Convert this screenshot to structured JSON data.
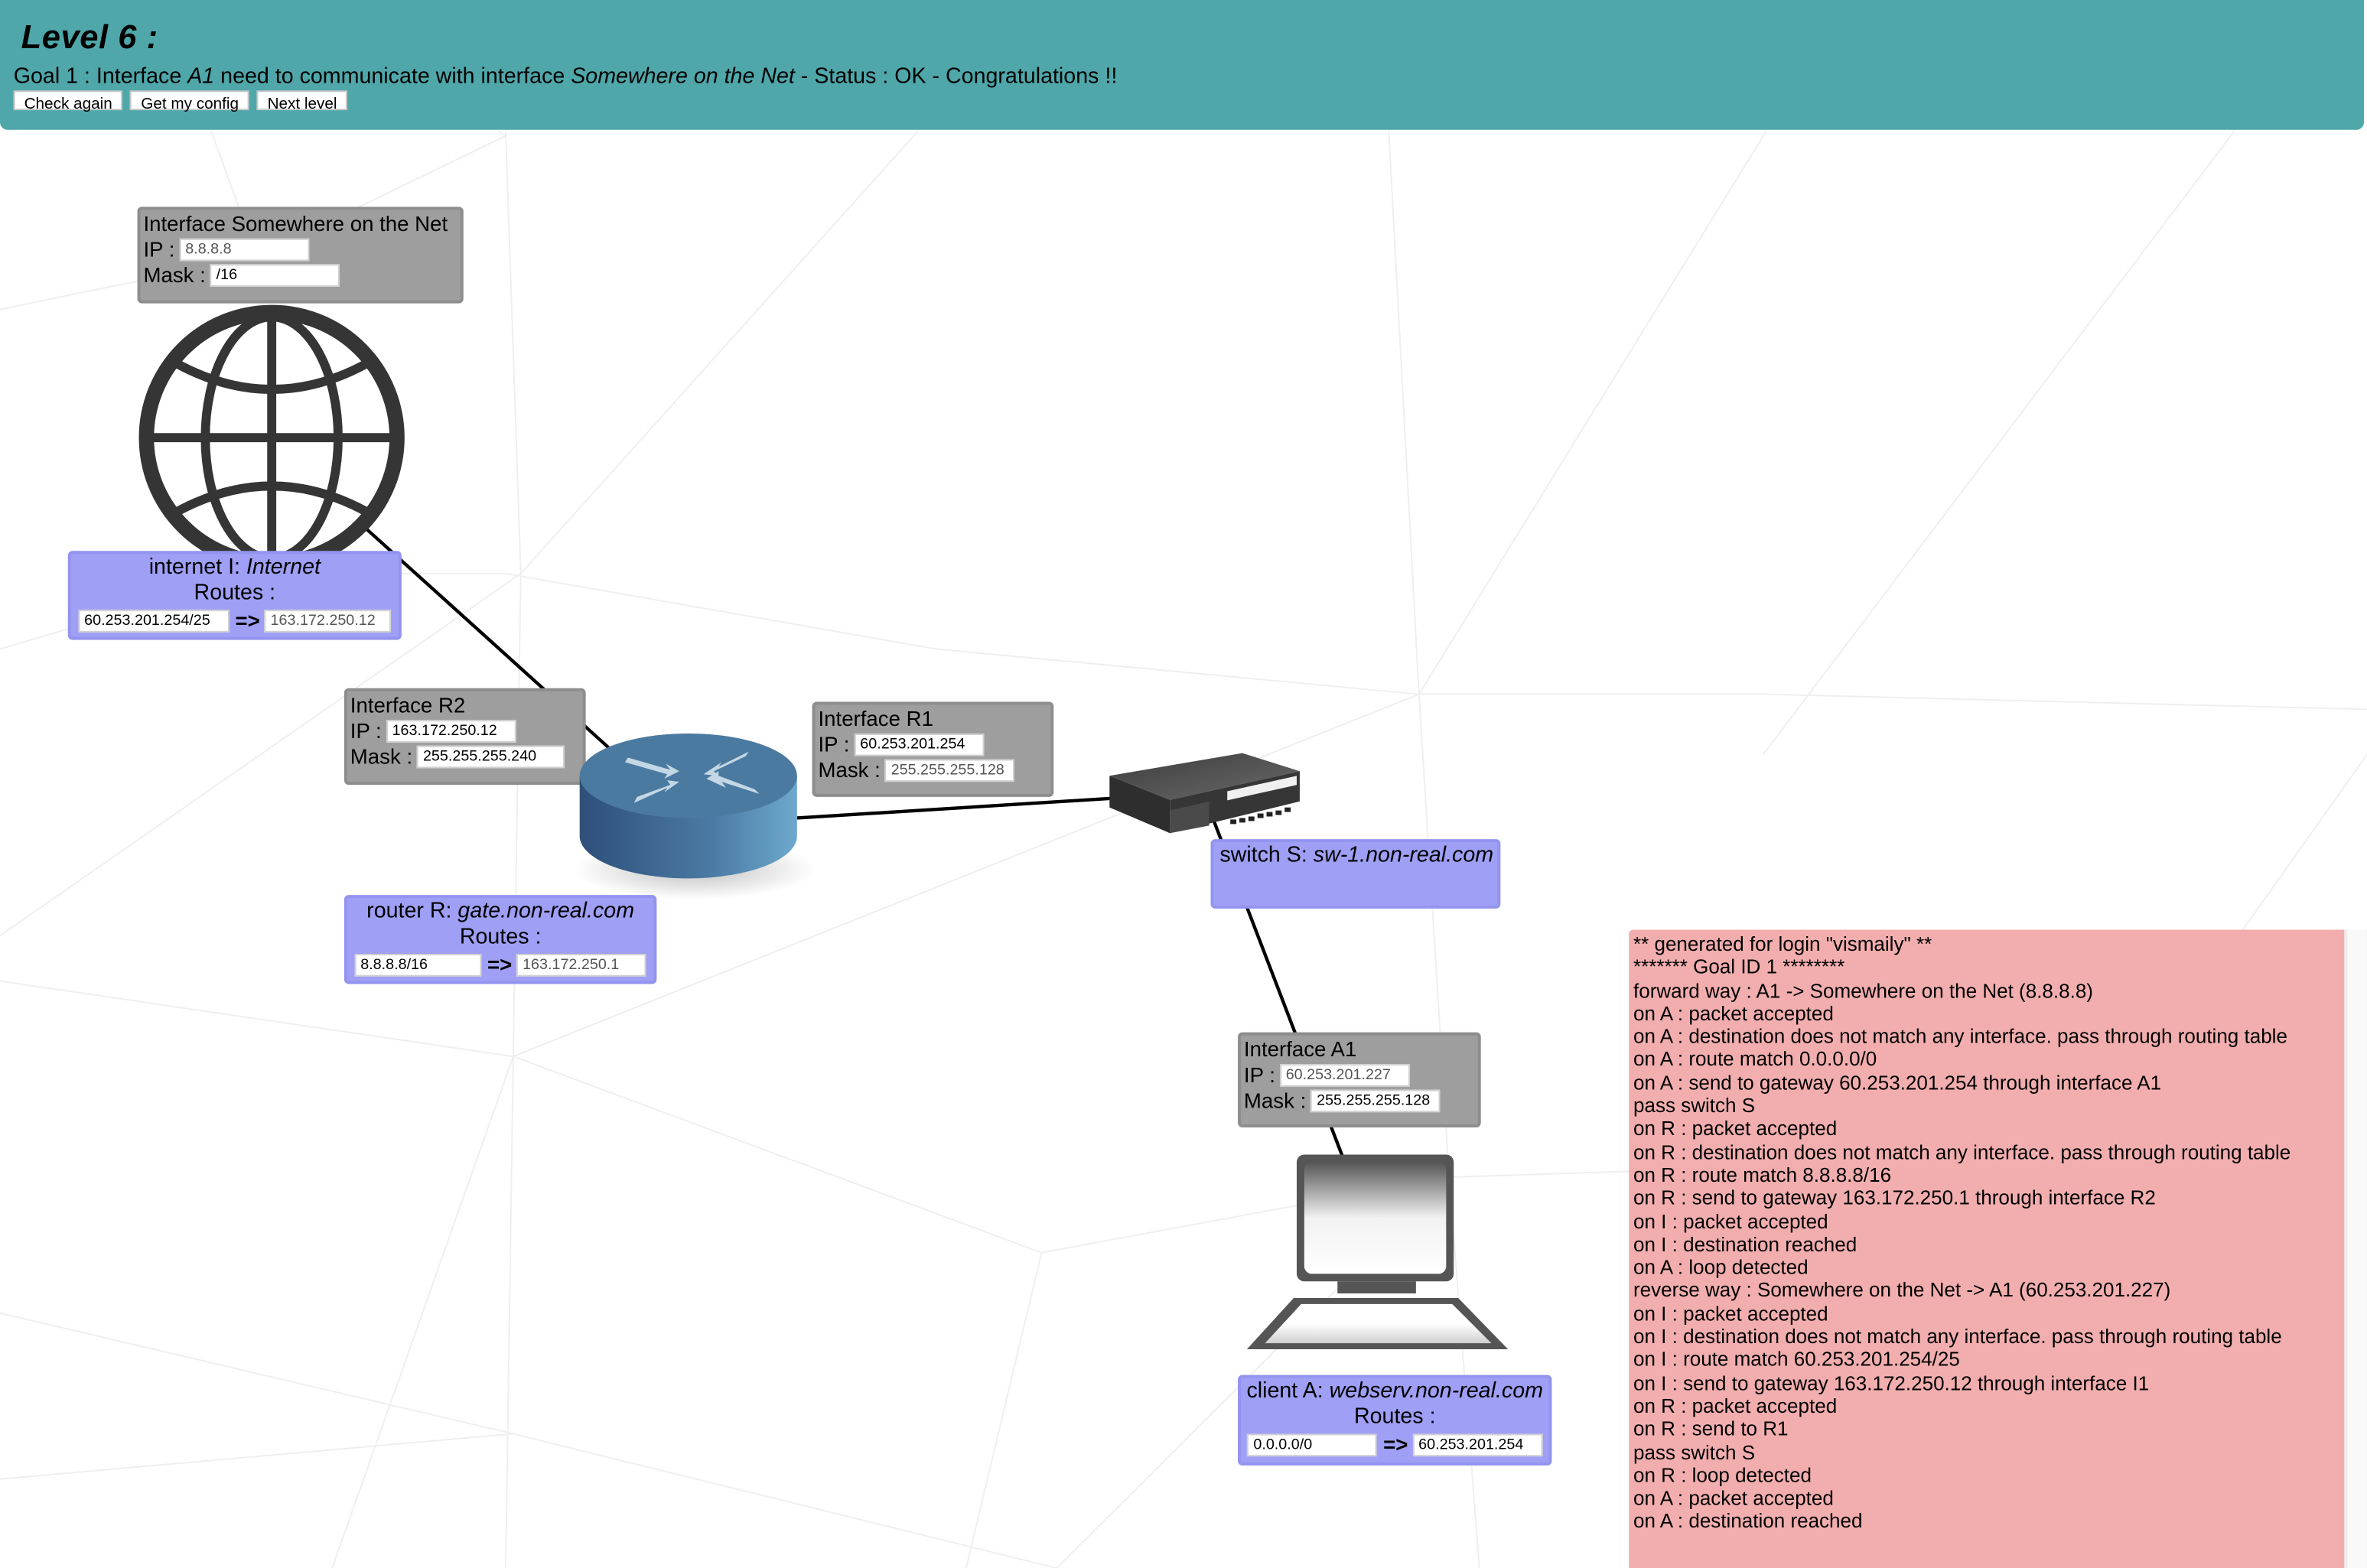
{
  "header": {
    "level_title": "Level 6 :",
    "goal": {
      "prefix": "Goal 1 : Interface ",
      "source": "A1",
      "middle": " need to communicate with interface ",
      "target": "Somewhere on the Net",
      "status": " - Status : OK - Congratulations !!"
    },
    "buttons": {
      "check_again": "Check again",
      "get_config": "Get my config",
      "next_level": "Next level"
    },
    "accent_color": "#4fa7aa"
  },
  "interfaces": {
    "net": {
      "title": "Interface Somewhere on the Net",
      "ip_label": "IP :",
      "ip": "8.8.8.8",
      "mask_label": "Mask :",
      "mask": "/16"
    },
    "r2": {
      "title": "Interface R2",
      "ip_label": "IP :",
      "ip": "163.172.250.12",
      "mask_label": "Mask :",
      "mask": "255.255.255.240"
    },
    "r1": {
      "title": "Interface R1",
      "ip_label": "IP :",
      "ip": "60.253.201.254",
      "mask_label": "Mask :",
      "mask": "255.255.255.128"
    },
    "a1": {
      "title": "Interface A1",
      "ip_label": "IP :",
      "ip": "60.253.201.227",
      "mask_label": "Mask :",
      "mask": "255.255.255.128"
    }
  },
  "nodes": {
    "internet": {
      "kind": "internet I: ",
      "name": "Internet",
      "routes_label": "Routes :",
      "routes": [
        {
          "dest": "60.253.201.254/25",
          "arrow": "=>",
          "gateway": "163.172.250.12"
        }
      ]
    },
    "router": {
      "kind": "router R: ",
      "name": "gate.non-real.com",
      "routes_label": "Routes :",
      "routes": [
        {
          "dest": "8.8.8.8/16",
          "arrow": "=>",
          "gateway": "163.172.250.1"
        }
      ]
    },
    "switch": {
      "kind": "switch S: ",
      "name": "sw-1.non-real.com"
    },
    "client": {
      "kind": "client A: ",
      "name": "webserv.non-real.com",
      "routes_label": "Routes :",
      "routes": [
        {
          "dest": "0.0.0.0/0",
          "arrow": "=>",
          "gateway": "60.253.201.254"
        }
      ]
    }
  },
  "icons": {
    "internet": "globe-icon",
    "router": "router-icon",
    "switch": "network-switch-icon",
    "client": "computer-icon"
  },
  "log": {
    "lines": [
      "** generated for login \"vismaily\" **",
      "******* Goal ID 1 ********",
      "forward way : A1 -> Somewhere on the Net (8.8.8.8)",
      "on A : packet accepted",
      "on A : destination does not match any interface. pass through routing table",
      "on A : route match 0.0.0.0/0",
      "on A : send to gateway 60.253.201.254 through interface A1",
      "pass switch S",
      "on R : packet accepted",
      "on R : destination does not match any interface. pass through routing table",
      "on R : route match 8.8.8.8/16",
      "on R : send to gateway 163.172.250.1 through interface R2",
      "on I : packet accepted",
      "on I : destination reached",
      "on A : loop detected",
      "reverse way : Somewhere on the Net -> A1 (60.253.201.227)",
      "on I : packet accepted",
      "on I : destination does not match any interface. pass through routing table",
      "on I : route match 60.253.201.254/25",
      "on I : send to gateway 163.172.250.12 through interface I1",
      "on R : packet accepted",
      "on R : send to R1",
      "pass switch S",
      "on R : loop detected",
      "on A : packet accepted",
      "on A : destination reached"
    ],
    "background_color": "#f2aeae"
  },
  "colors": {
    "interface_box": "#9e9e9e",
    "node_box": "#9e9ff5"
  }
}
